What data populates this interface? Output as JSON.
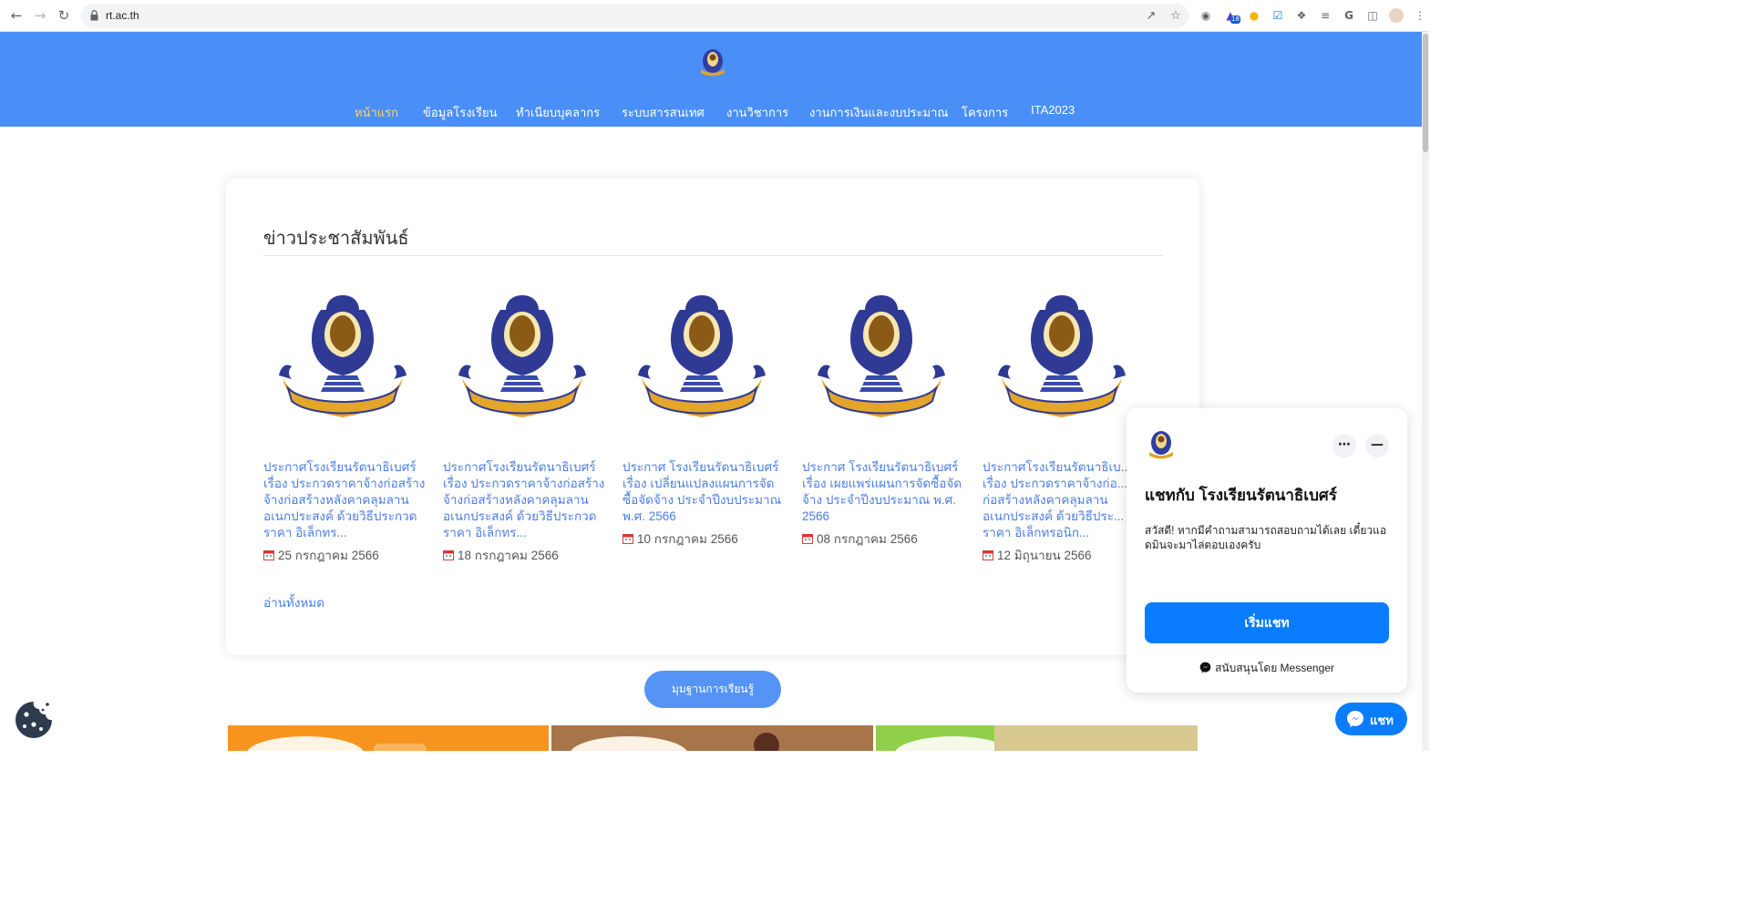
{
  "browser": {
    "url": "rt.ac.th",
    "extension_badge": "18"
  },
  "nav": {
    "items": [
      "หน้าแรก",
      "ข้อมูลโรงเรียน",
      "ทำเนียบบุคลากร",
      "ระบบสารสนเทศ",
      "งานวิชาการ",
      "งานการเงินและงบประมาณ",
      "โครงการ",
      "ITA2023"
    ],
    "active": "หน้าแรก"
  },
  "news": {
    "heading": "ข่าวประชาสัมพันธ์",
    "items": [
      {
        "title": "ประกาศโรงเรียนรัตนาธิเบศร์ เรื่อง ประกวดราคาจ้างก่อสร้างจ้างก่อสร้างหลังคาคลุมลานอเนกประสงค์ ด้วยวิธีประกวดราคา อิเล็กทร...",
        "date": "25 กรกฎาคม 2566"
      },
      {
        "title": "ประกาศโรงเรียนรัตนาธิเบศร์ เรื่อง ประกวดราคาจ้างก่อสร้างจ้างก่อสร้างหลังคาคลุมลานอเนกประสงค์ ด้วยวิธีประกวดราคา อิเล็กทร...",
        "date": "18 กรกฎาคม 2566"
      },
      {
        "title": "ประกาศ โรงเรียนรัตนาธิเบศร์ เรื่อง เปลี่ยนแปลงแผนการจัดซื้อจัดจ้าง ประจำปีงบประมาณ พ.ศ. 2566",
        "date": "10 กรกฎาคม 2566"
      },
      {
        "title": "ประกาศ โรงเรียนรัตนาธิเบศร์ เรื่อง เผยแพร่แผนการจัดซื้อจัดจ้าง ประจำปีงบประมาณ พ.ศ. 2566",
        "date": "08 กรกฎาคม 2566"
      },
      {
        "title": "ประกาศโรงเรียนรัตนาธิเบ... เรื่อง ประกวดราคาจ้างก่อ... ก่อสร้างหลังคาคลุมลาน อเนกประสงค์ ด้วยวิธีประ... ราคา อิเล็กทรอนิก...",
        "date": "12 มิถุนายน 2566"
      }
    ],
    "read_all": "อ่านทั้งหมด"
  },
  "learning_button": "มุมฐานการเรียนรู้",
  "messenger": {
    "heading": "แชทกับ โรงเรียนรัตนาธิเบศร์",
    "greeting": "สวัสดี! หากมีคำถามสามารถสอบถามได้เลย เดี๋ยวแอดมินจะมาไล่ตอบเองครับ",
    "start_label": "เริ่มแชท",
    "powered": "สนับสนุนโดย Messenger",
    "fab_label": "แชท"
  },
  "colors": {
    "header_blue": "#4a8ff7",
    "nav_active": "#ffd36a",
    "link_blue": "#4a7de6",
    "messenger_blue": "#0a7cff"
  }
}
